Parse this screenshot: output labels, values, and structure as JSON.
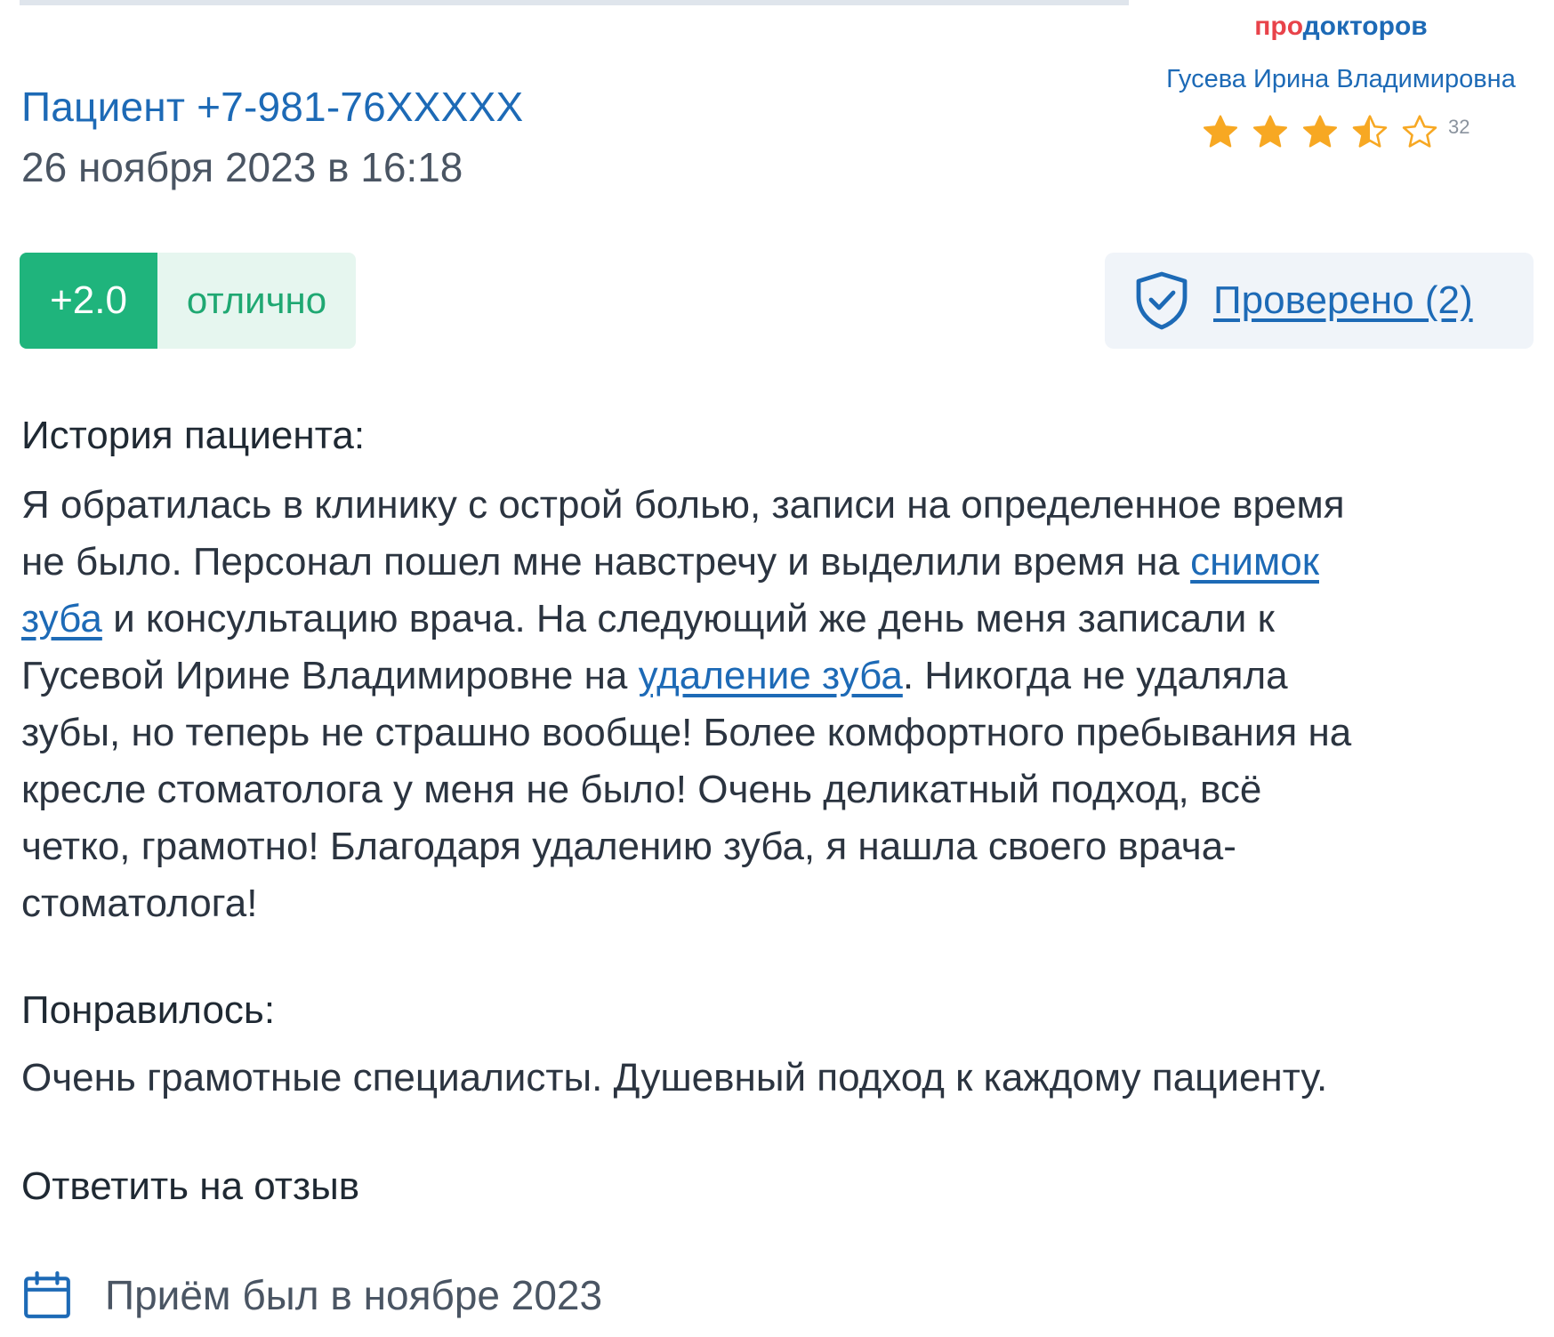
{
  "header": {
    "patient_name": "Пациент +7-981-76XXXXX",
    "date": "26 ноября 2023 в 16:18"
  },
  "widget": {
    "logo_part1": "про",
    "logo_part2": "докторов",
    "doctor_name": "Гусева Ирина Владимировна",
    "rating_stars": 3.5,
    "rating_max": 5,
    "reviews_count": "32",
    "star_color": "#f7a823"
  },
  "rating": {
    "score": "+2.0",
    "label": "отлично",
    "score_bg": "#1fb47c",
    "label_bg": "#e6f6ef"
  },
  "verified": {
    "label": "Проверено (2)",
    "icon": "shield-check-icon"
  },
  "history": {
    "title": "История пациента:",
    "line1": "Я обратилась в клинику с острой болью, записи на определенное время",
    "line2_text": "не было. Персонал пошел мне навстречу и выделили время на ",
    "line2_link": "снимок",
    "line3_link": "зуба",
    "line3_text": " и консультацию врача. На следующий же день меня записали к",
    "line4_text": "Гусевой Ирине Владимировне на ",
    "line4_link": "удаление зуба",
    "line4_tail": ". Никогда не удаляла",
    "line5": "зубы, но теперь не страшно вообще! Более комфортного пребывания на",
    "line6": "кресле стоматолога у меня не было! Очень деликатный подход, всё",
    "line7": "четко, грамотно! Благодаря удалению зуба, я нашла своего врача-",
    "line8": "стоматолога!"
  },
  "liked": {
    "title": "Понравилось:",
    "text": "Очень грамотные специалисты. Душевный подход к каждому пациенту."
  },
  "actions": {
    "reply": "Ответить на отзыв"
  },
  "visit": {
    "icon": "calendar-icon",
    "text": "Приём был в ноябре 2023"
  },
  "colors": {
    "link_blue": "#1d6ab6",
    "text_dark": "#1f2933",
    "text_gray": "#4a5563",
    "brand_red": "#e8434a"
  }
}
